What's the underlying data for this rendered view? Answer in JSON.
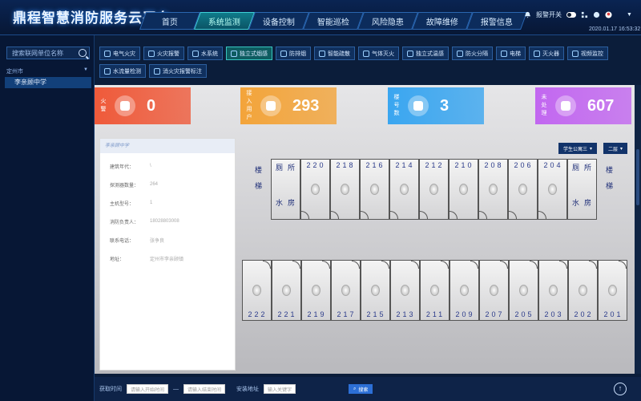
{
  "header": {
    "title": "鼎程智慧消防服务云平台",
    "nav": [
      "首页",
      "系统监测",
      "设备控制",
      "智能巡检",
      "风险隐患",
      "故障维修",
      "报警信息"
    ],
    "active_nav": 1,
    "alarm_switch": "报警开关",
    "date": "2020.01.17",
    "time": "16:53:32"
  },
  "sidebar": {
    "search_placeholder": "搜索联网单位名称",
    "city": "定州市",
    "school": "李亲顾中学"
  },
  "toolbar": {
    "buttons": [
      "电气火灾",
      "火灾报警",
      "水系统",
      "独立式烟感",
      "防排烟",
      "智能疏散",
      "气体灭火",
      "独立式温感",
      "防火分隔",
      "电梯",
      "灭火器",
      "视频监控",
      "水流量检测",
      "消火灾报警标注"
    ],
    "active": 3
  },
  "stats": [
    {
      "label": "火警",
      "value": "0",
      "color": "#ef5a3a"
    },
    {
      "label": "接入用户",
      "value": "293",
      "color": "#f3a43a"
    },
    {
      "label": "楼号数",
      "value": "3",
      "color": "#3aa6f0"
    },
    {
      "label": "未处理",
      "value": "607",
      "color": "#c267f0"
    }
  ],
  "info": {
    "title": "李亲顾中学",
    "rows": [
      {
        "k": "建筑年代：",
        "v": "\\"
      },
      {
        "k": "探测器数量：",
        "v": "264"
      },
      {
        "k": "主机型号：",
        "v": "1"
      },
      {
        "k": "消防负责人：",
        "v": "18028803008"
      },
      {
        "k": "联系电话：",
        "v": "张争良"
      },
      {
        "k": "地址：",
        "v": "定州市李亲顾镇"
      }
    ]
  },
  "plan": {
    "building_select": "学生公寓三",
    "floor_select": "二层",
    "stair_label": "楼梯",
    "toilet_label": "厕所",
    "water_room_label": "水房",
    "top_rooms": [
      "220",
      "218",
      "216",
      "214",
      "212",
      "210",
      "208",
      "206",
      "204"
    ],
    "bottom_rooms": [
      "222",
      "221",
      "219",
      "217",
      "215",
      "213",
      "211",
      "209",
      "207",
      "205",
      "203",
      "202",
      "201"
    ]
  },
  "footer": {
    "time_label": "获取时间",
    "start_placeholder": "请输入开始时间",
    "sep": "—",
    "end_placeholder": "请输入结束时间",
    "addr_label": "安装地址",
    "addr_placeholder": "输入关键字",
    "search_label": "搜索"
  }
}
